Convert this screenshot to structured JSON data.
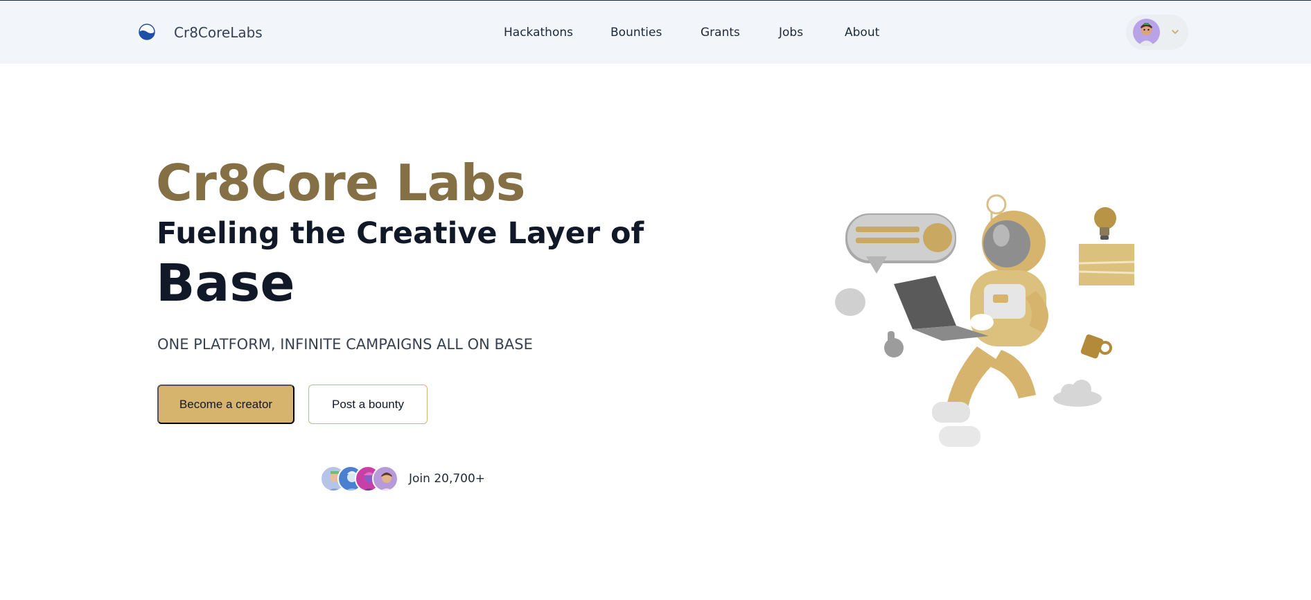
{
  "header": {
    "brand": "Cr8CoreLabs",
    "nav": [
      "Hackathons",
      "Bounties",
      "Grants",
      "Jobs",
      "About"
    ]
  },
  "hero": {
    "title": "Cr8Core Labs",
    "subtitle": "Fueling the Creative Layer of",
    "highlight": "Base",
    "tagline": "ONE PLATFORM, INFINITE CAMPAIGNS ALL ON BASE",
    "primary_button": "Become a creator",
    "secondary_button": "Post a bounty",
    "join_text": "Join 20,700+"
  },
  "colors": {
    "accent": "#d6b46e",
    "title": "#857046",
    "header_bg": "#f2f6fa"
  },
  "icons": {
    "logo": "half-circle-logo-icon",
    "user_menu": "chevron-down-icon"
  }
}
